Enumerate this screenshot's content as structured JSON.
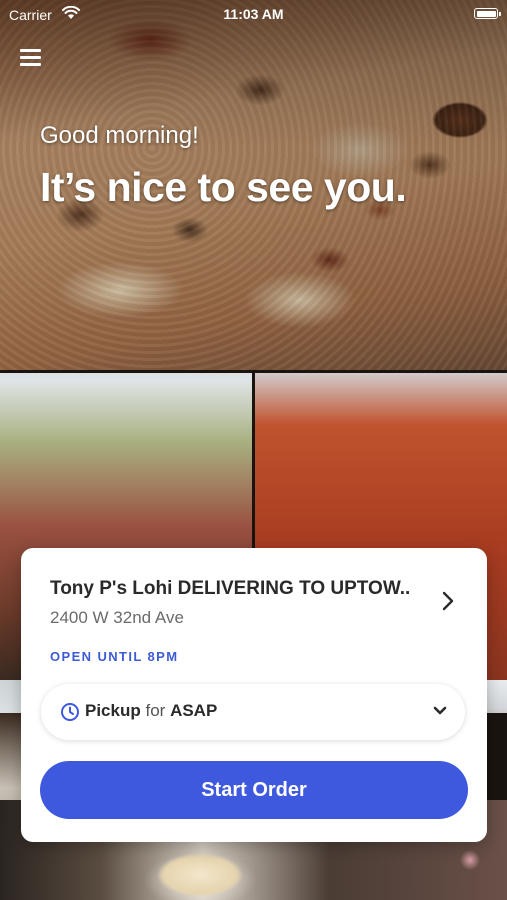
{
  "status_bar": {
    "carrier": "Carrier",
    "time": "11:03 AM"
  },
  "hero": {
    "greeting": "Good morning!",
    "headline": "It’s nice to see you."
  },
  "card": {
    "store_name": "Tony P's Lohi DELIVERING TO UPTOW...",
    "store_address": "2400 W 32nd Ave",
    "hours": "OPEN UNTIL 8PM",
    "mode": "Pickup",
    "mode_for": "for",
    "mode_time": "ASAP",
    "start_button": "Start Order"
  },
  "colors": {
    "accent": "#3e59de",
    "hours_text": "#3c5bd6"
  },
  "icons": [
    "menu-icon",
    "wifi-icon",
    "battery-icon",
    "chevron-right-icon",
    "clock-icon",
    "chevron-down-icon"
  ]
}
